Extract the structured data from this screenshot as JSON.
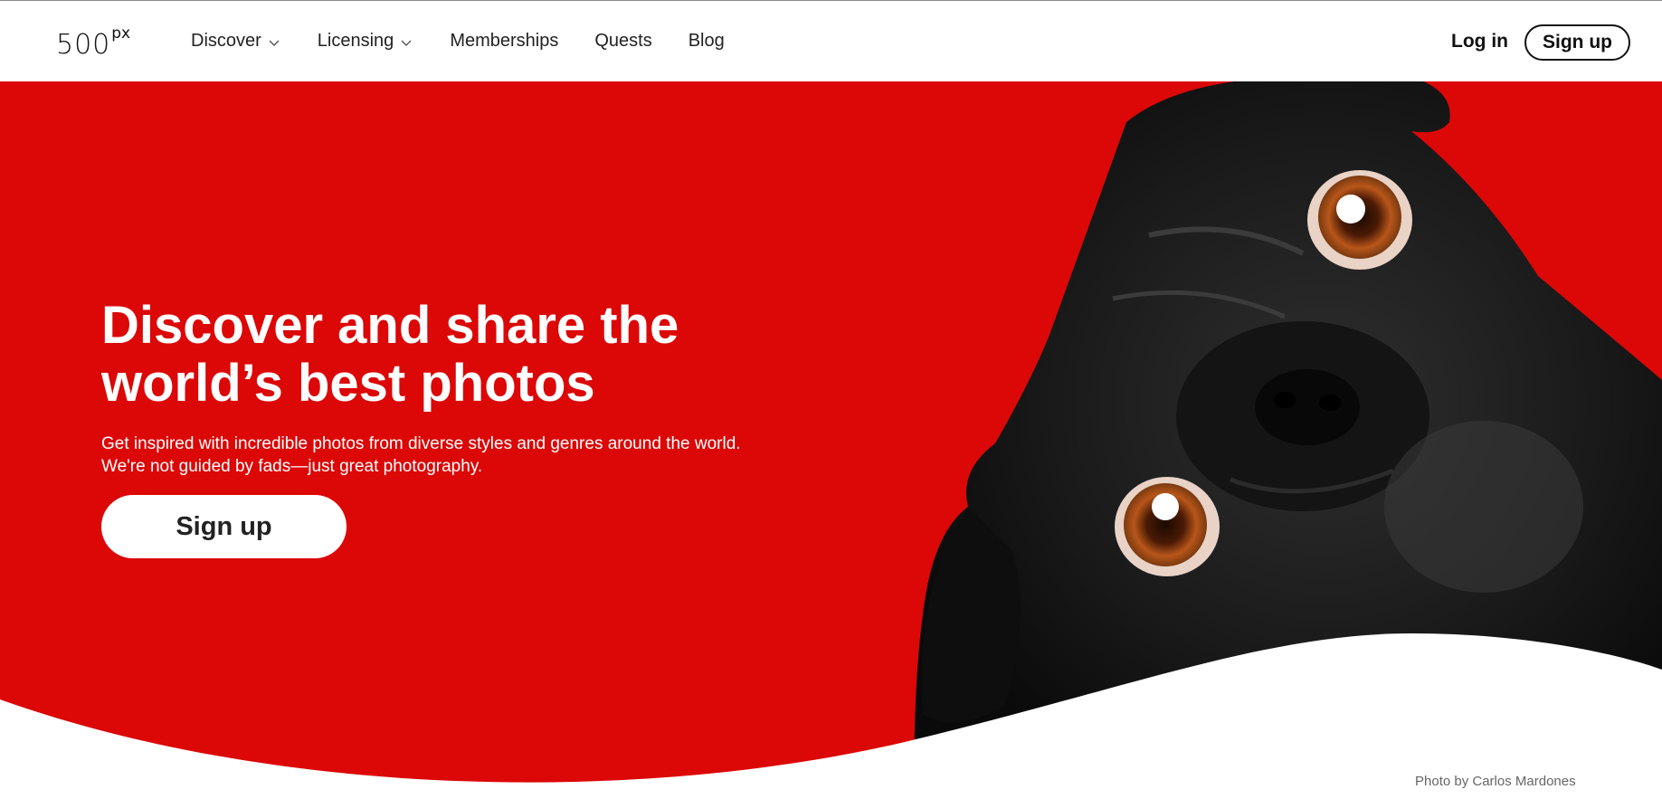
{
  "brand": {
    "logo_main": "500",
    "logo_sup": "px"
  },
  "nav": {
    "items": [
      {
        "label": "Discover",
        "dropdown": true
      },
      {
        "label": "Licensing",
        "dropdown": true
      },
      {
        "label": "Memberships",
        "dropdown": false
      },
      {
        "label": "Quests",
        "dropdown": false
      },
      {
        "label": "Blog",
        "dropdown": false
      }
    ],
    "login_label": "Log in",
    "signup_label": "Sign up"
  },
  "hero": {
    "headline_line1": "Discover and share the",
    "headline_line2": "world’s best photos",
    "subtext": "Get inspired with incredible photos from diverse styles and genres around the world. We're not guided by fads—just great photography.",
    "cta_label": "Sign up",
    "photo_credit": "Photo by Carlos Mardones"
  },
  "colors": {
    "hero_red": "#dc0707",
    "text_dark": "#222222",
    "white": "#ffffff"
  }
}
